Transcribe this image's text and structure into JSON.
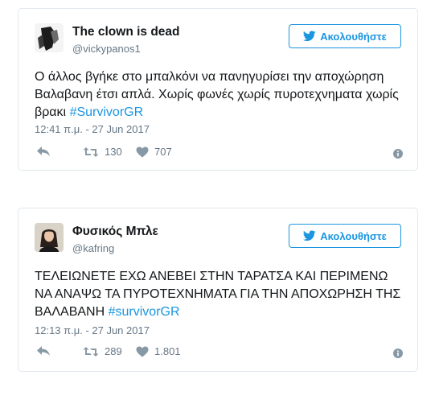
{
  "tweets": [
    {
      "display_name": "The clown is dead",
      "handle": "@vickypanos1",
      "follow_label": "Ακολουθήστε",
      "text_plain": "Ο άλλος βγήκε στο μπαλκόνι να πανηγυρίσει την αποχώρηση Βαλαβανη έτσι απλά. Χωρίς φωνές χωρίς πυροτεχνηματα χωρίς βρακι ",
      "hashtag": "#SurvivorGR",
      "timestamp": "12:41 π.μ. - 27 Jun 2017",
      "retweets": "130",
      "likes": "707"
    },
    {
      "display_name": "Φυσικός Μπλε",
      "handle": "@kafring",
      "follow_label": "Ακολουθήστε",
      "text_plain": "ΤΕΛΕΙΩΝΕΤΕ ΕΧΩ ΑΝΕΒΕΙ ΣΤΗΝ ΤΑΡΑΤΣΑ ΚΑΙ ΠΕΡΙΜΕΝΩ ΝΑ ΑΝΑΨΩ ΤΑ ΠΥΡΟΤΕΧΝΗΜΑΤΑ ΓΙΑ ΤΗΝ ΑΠΟΧΩΡΗΣΗ ΤΗΣ ΒΑΛΑΒΑΝΗ ",
      "hashtag": "#survivorGR",
      "timestamp": "12:13 π.μ. - 27 Jun 2017",
      "retweets": "289",
      "likes": "1.801"
    }
  ],
  "icons": {
    "reply": "reply-icon",
    "retweet": "retweet-icon",
    "like": "heart-icon",
    "info": "info-icon",
    "bird": "twitter-bird-icon"
  },
  "colors": {
    "accent": "#1b95e0",
    "muted": "#8899a6",
    "border": "#e1e8ed"
  }
}
